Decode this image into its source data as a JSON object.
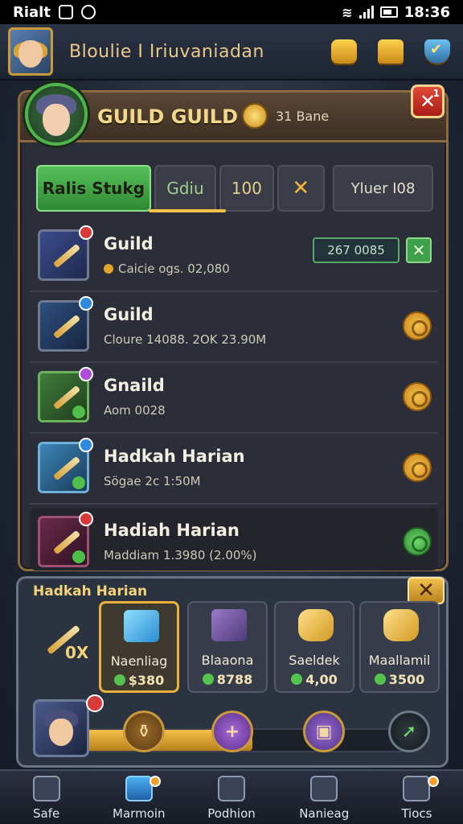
{
  "status_bar": {
    "carrier": "Rialt",
    "time": "18:36"
  },
  "header": {
    "player_name": "Bloulie I Iriuvaniadan"
  },
  "panel": {
    "title": "GUILD GUILD",
    "coin_text": "31 Bane",
    "close_badge": "1",
    "tabs": [
      {
        "label": "Ralis Stukg"
      },
      {
        "label": "Gdiu"
      },
      {
        "label": "100"
      },
      {
        "label": "✕"
      },
      {
        "label": "Yluer  I08"
      }
    ],
    "items": [
      {
        "name": "Guild",
        "sub": "Caicie ogs. 02,080",
        "value": "267 0085",
        "has_check": true
      },
      {
        "name": "Guild",
        "sub": "Cloure 14088. 2OK 23.90M"
      },
      {
        "name": "Gnaild",
        "sub": "Aom 0028"
      },
      {
        "name": "Hadkah Harian",
        "sub": "Sögae 2c 1:50M"
      },
      {
        "name": "Hadiah Harian",
        "sub": "Maddiam 1.3980 (2.00%)"
      }
    ]
  },
  "shop": {
    "title": "Hadkah Harian",
    "arrow_count": "0X",
    "cards": [
      {
        "name": "Naenliag",
        "price": "$380"
      },
      {
        "name": "Blaaona",
        "price": "8788"
      },
      {
        "name": "Saeldek",
        "price": "4,00"
      },
      {
        "name": "Maallamil",
        "price": "3500"
      }
    ],
    "progress": 0.55
  },
  "nav": {
    "items": [
      {
        "label": "Safe"
      },
      {
        "label": "Marmoin"
      },
      {
        "label": "Podhion"
      },
      {
        "label": "Nanieag"
      },
      {
        "label": "Tiocs"
      }
    ]
  }
}
